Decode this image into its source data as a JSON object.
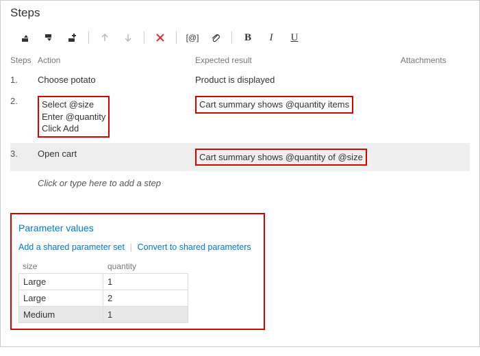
{
  "title": "Steps",
  "headers": {
    "steps": "Steps",
    "action": "Action",
    "expected": "Expected result",
    "attach": "Attachments"
  },
  "rows": [
    {
      "num": "1.",
      "action": "Choose potato",
      "expected": "Product is displayed",
      "hl": false
    },
    {
      "num": "2.",
      "action": "Select @size\nEnter @quantity\nClick Add",
      "expected": "Cart summary shows @quantity items",
      "hl": true
    },
    {
      "num": "3.",
      "action": "Open cart",
      "expected": "Cart summary shows @quantity of @size",
      "hl": true,
      "sel": true
    }
  ],
  "placeholder": "Click or type here to add a step",
  "params": {
    "title": "Parameter values",
    "link_add": "Add a shared parameter set",
    "link_convert": "Convert to shared parameters",
    "cols": {
      "size": "size",
      "qty": "quantity"
    },
    "data": [
      {
        "size": "Large",
        "qty": "1"
      },
      {
        "size": "Large",
        "qty": "2"
      },
      {
        "size": "Medium",
        "qty": "1",
        "sel": true
      }
    ]
  }
}
